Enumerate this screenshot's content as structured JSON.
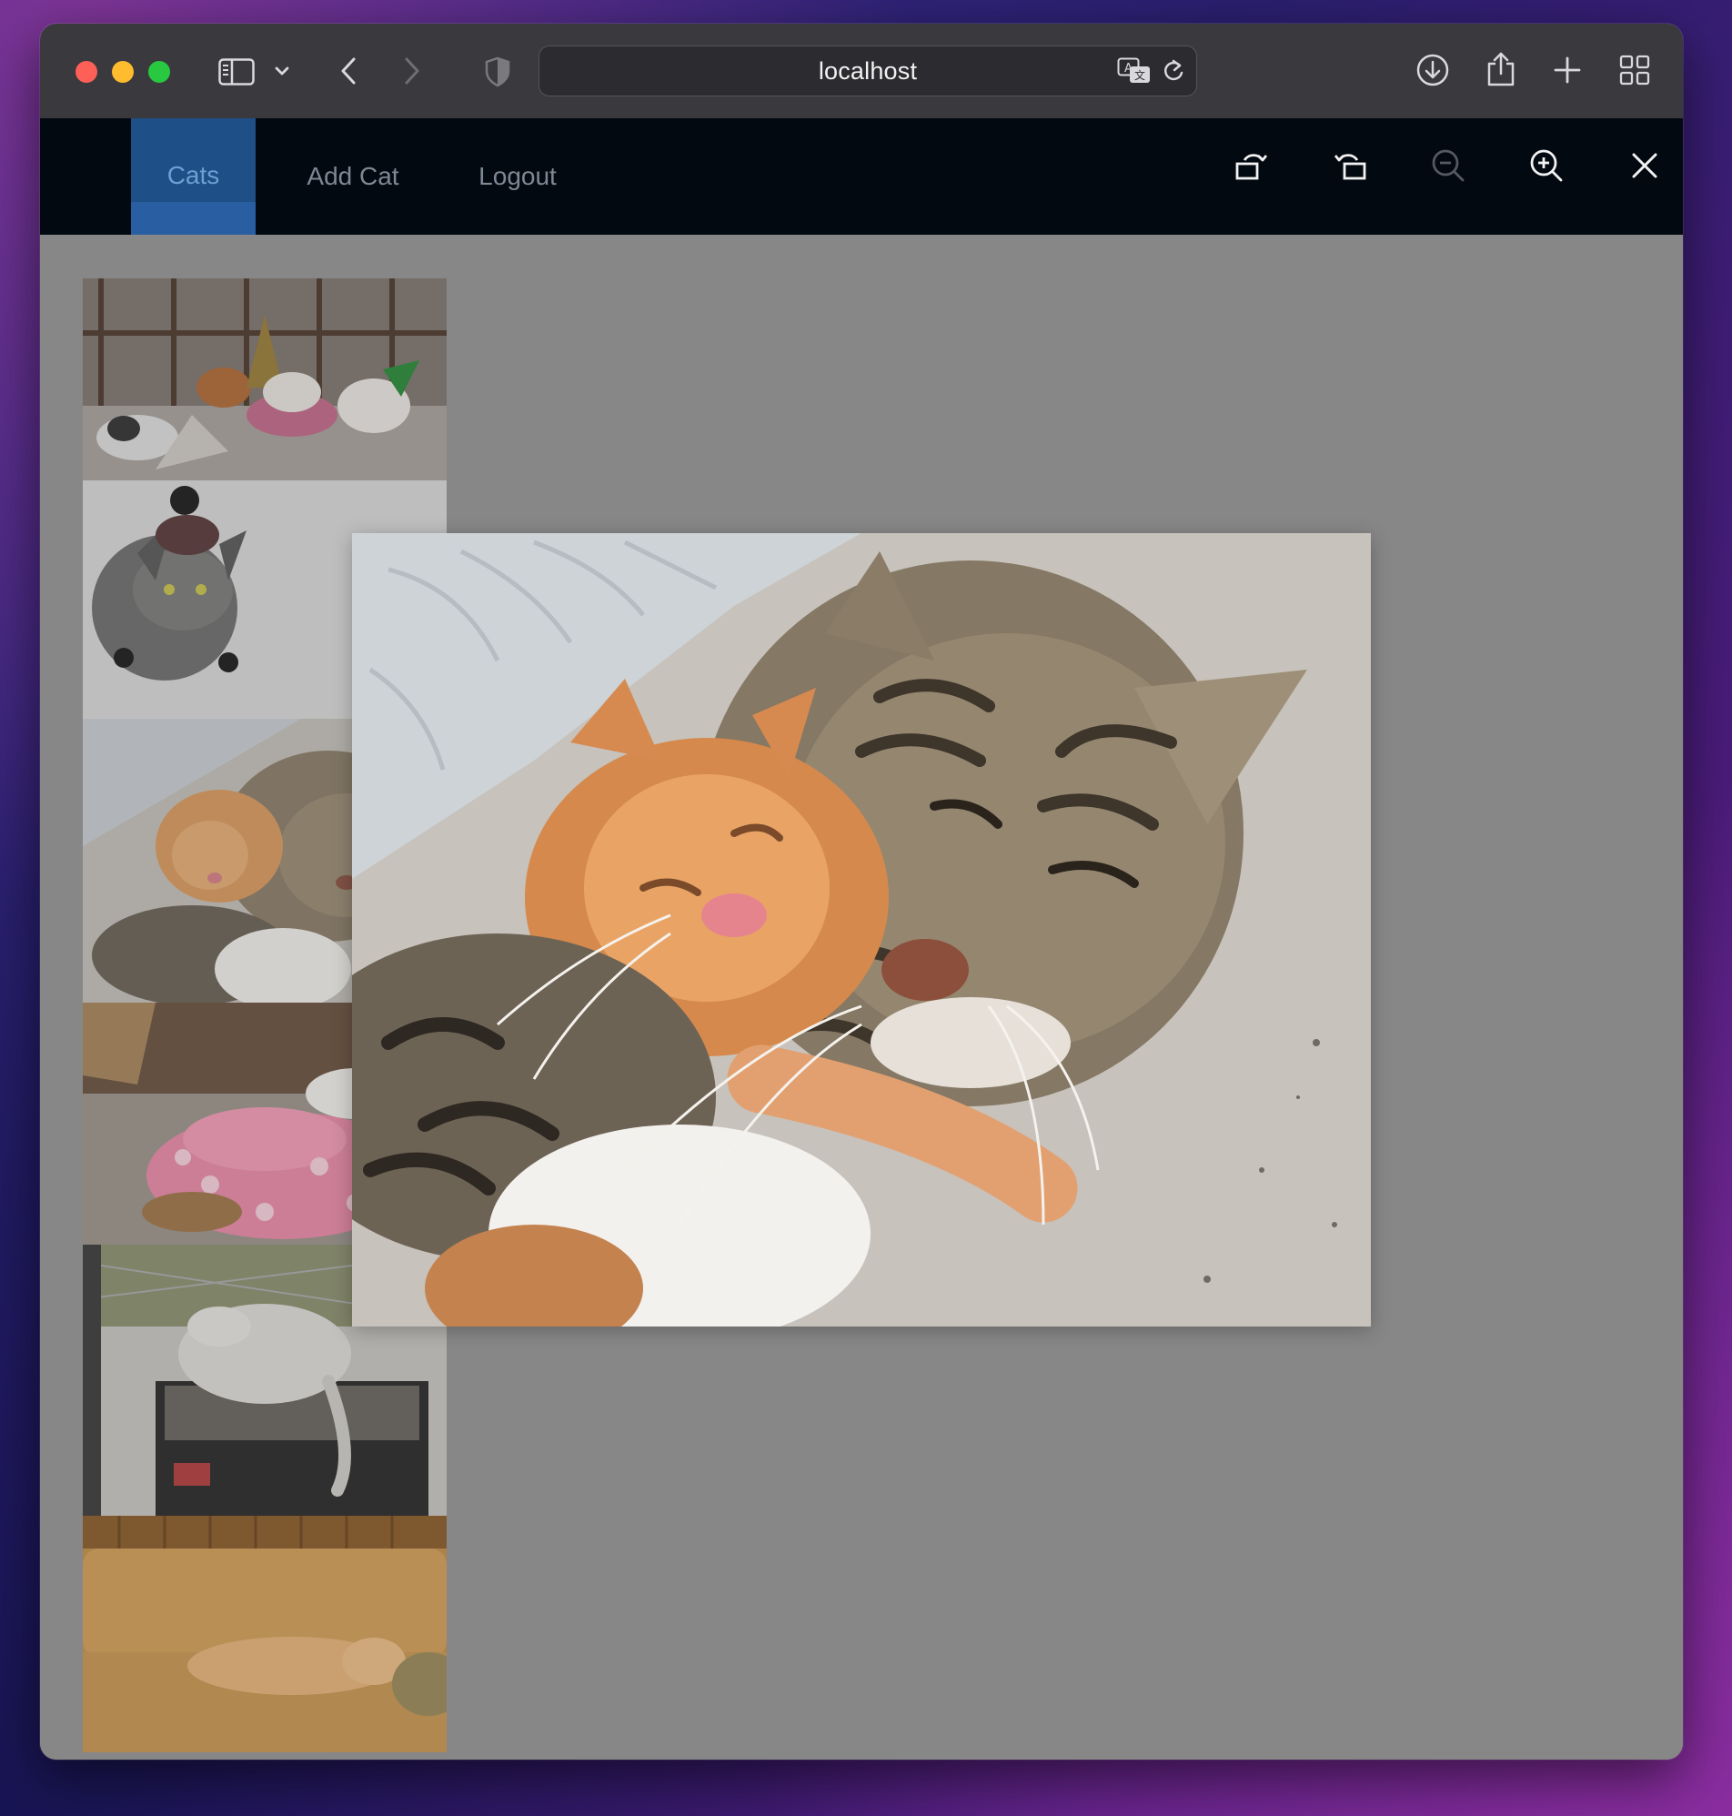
{
  "browser": {
    "url": "localhost",
    "icons": {
      "sidebar": "sidebar-icon",
      "sidebar_menu": "chevron-down-icon",
      "back": "chevron-left-icon",
      "forward": "chevron-right-icon",
      "privacy": "shield-icon",
      "translate": "translate-icon",
      "reload": "reload-icon",
      "downloads": "download-icon",
      "share": "share-icon",
      "new_tab": "plus-icon",
      "tab_overview": "grid-icon"
    }
  },
  "nav": {
    "items": [
      {
        "label": "Cats",
        "active": true
      },
      {
        "label": "Add Cat",
        "active": false
      },
      {
        "label": "Logout",
        "active": false
      }
    ]
  },
  "viewer": {
    "tools": [
      "rotate-left-icon",
      "rotate-right-icon",
      "zoom-out-icon",
      "zoom-in-icon",
      "close-icon"
    ]
  },
  "gallery": {
    "thumbnails": [
      "party-cats-photo",
      "cat-in-hat-photo",
      "kitten-and-cat-photo",
      "cat-on-blanket-photo",
      "sleeping-cat-on-box-photo",
      "cat-on-sofa-photo"
    ],
    "open_image": "kitten-and-cat-photo"
  },
  "colors": {
    "navbar_bg": "#030910",
    "active_tab": "#1e4f86",
    "page_bg": "#878787",
    "toolbar_bg": "#3a393d"
  }
}
